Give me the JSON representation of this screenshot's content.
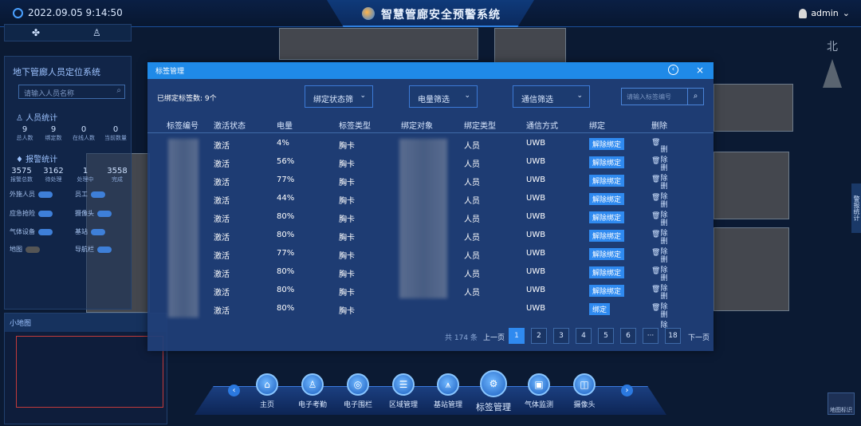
{
  "header": {
    "time": "2022.09.05 9:14:50",
    "title": "智慧管廊安全预警系统",
    "user": "admin"
  },
  "left_panel": {
    "title": "地下管廊人员定位系统",
    "search_placeholder": "请输入人员名称",
    "personnel_section": "人员统计",
    "personnel_stats": [
      {
        "value": "9",
        "label": "总人数"
      },
      {
        "value": "9",
        "label": "绑定数"
      },
      {
        "value": "0",
        "label": "在线人数"
      },
      {
        "value": "0",
        "label": "当前数量"
      }
    ],
    "alarm_section": "报警统计",
    "alarm_stats": [
      {
        "value": "3575",
        "label": "报警总数"
      },
      {
        "value": "3162",
        "label": "待处理"
      },
      {
        "value": "1",
        "label": "处理中"
      },
      {
        "value": "3558",
        "label": "完成"
      }
    ],
    "toggles": [
      "外施人员",
      "员工",
      "应急抢险",
      "摄像头",
      "气体设备",
      "基站",
      "地图",
      "导航栏"
    ],
    "minimap_title": "小地图"
  },
  "right": {
    "compass": "北",
    "map_label": "地图标识",
    "side_tab": "警报统计"
  },
  "modal": {
    "title": "标签管理",
    "bound_count": "已绑定标签数: 9个",
    "filters": {
      "status": "绑定状态筛",
      "battery": "电量筛选",
      "comm": "通信筛选"
    },
    "search_placeholder": "请输入标签编号",
    "columns": [
      "标签编号",
      "激活状态",
      "电量",
      "标签类型",
      "绑定对象",
      "绑定类型",
      "通信方式",
      "绑定",
      "删除"
    ],
    "rows": [
      {
        "status": "激活",
        "battery": "4%",
        "type": "胸卡",
        "bind_type": "人员",
        "comm": "UWB",
        "action": "解除绑定",
        "delete": "删除"
      },
      {
        "status": "激活",
        "battery": "56%",
        "type": "胸卡",
        "bind_type": "人员",
        "comm": "UWB",
        "action": "解除绑定",
        "delete": "删除"
      },
      {
        "status": "激活",
        "battery": "77%",
        "type": "胸卡",
        "bind_type": "人员",
        "comm": "UWB",
        "action": "解除绑定",
        "delete": "删除"
      },
      {
        "status": "激活",
        "battery": "44%",
        "type": "胸卡",
        "bind_type": "人员",
        "comm": "UWB",
        "action": "解除绑定",
        "delete": "删除"
      },
      {
        "status": "激活",
        "battery": "80%",
        "type": "胸卡",
        "bind_type": "人员",
        "comm": "UWB",
        "action": "解除绑定",
        "delete": "删除"
      },
      {
        "status": "激活",
        "battery": "80%",
        "type": "胸卡",
        "bind_type": "人员",
        "comm": "UWB",
        "action": "解除绑定",
        "delete": "删除"
      },
      {
        "status": "激活",
        "battery": "77%",
        "type": "胸卡",
        "bind_type": "人员",
        "comm": "UWB",
        "action": "解除绑定",
        "delete": "删除"
      },
      {
        "status": "激活",
        "battery": "80%",
        "type": "胸卡",
        "bind_type": "人员",
        "comm": "UWB",
        "action": "解除绑定",
        "delete": "删除"
      },
      {
        "status": "激活",
        "battery": "80%",
        "type": "胸卡",
        "bind_type": "人员",
        "comm": "UWB",
        "action": "解除绑定",
        "delete": "删除"
      },
      {
        "status": "激活",
        "battery": "80%",
        "type": "胸卡",
        "bind_type": "",
        "comm": "UWB",
        "action": "绑定",
        "delete": "删除"
      }
    ],
    "pagination": {
      "total": "共 174 条",
      "prev": "上一页",
      "pages": [
        "1",
        "2",
        "3",
        "4",
        "5",
        "6",
        "···",
        "18"
      ],
      "next": "下一页",
      "current": "1"
    }
  },
  "dock": {
    "items": [
      "主页",
      "电子考勤",
      "电子围栏",
      "区域管理",
      "基站管理",
      "标签管理",
      "气体监测",
      "摄像头"
    ]
  }
}
